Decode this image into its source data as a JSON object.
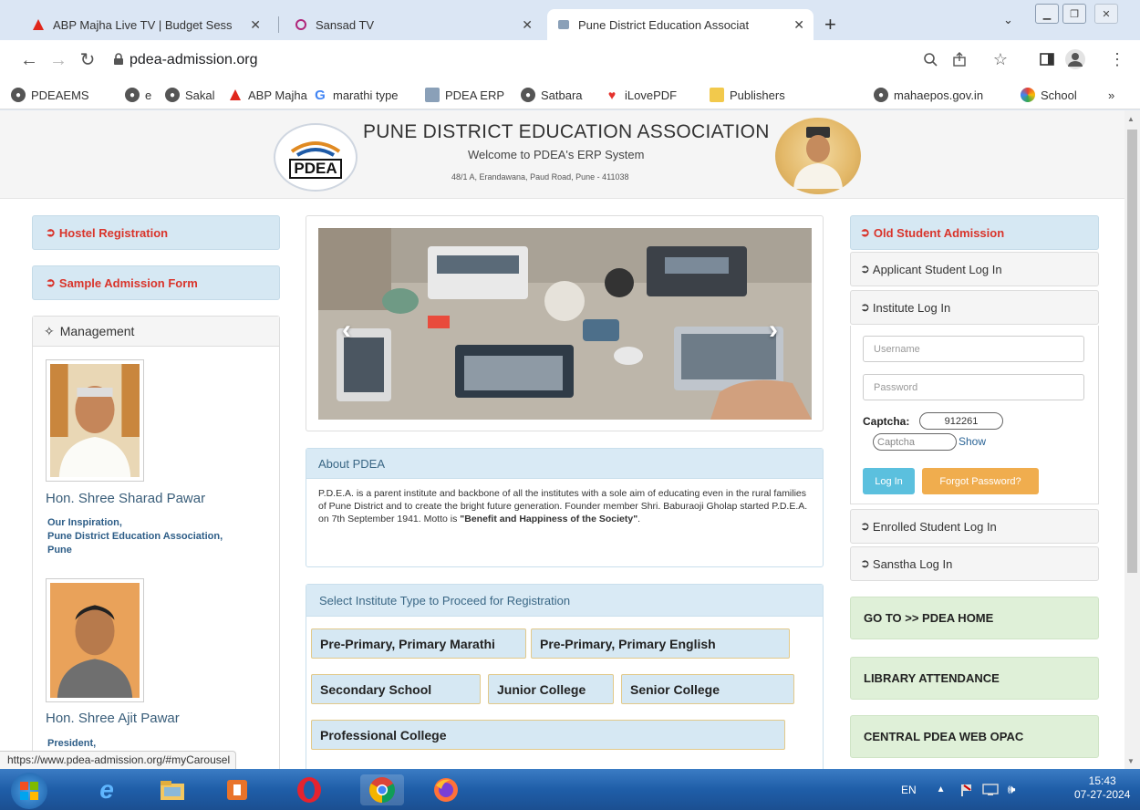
{
  "browser": {
    "tabs": [
      {
        "title": "ABP Majha Live TV | Budget Sess",
        "active": false
      },
      {
        "title": "Sansad TV",
        "active": false
      },
      {
        "title": "Pune District Education Associat",
        "active": true
      }
    ],
    "url": "pdea-admission.org",
    "bookmarks": [
      "PDEAEMS",
      "e",
      "Sakal",
      "ABP Majha",
      "marathi type",
      "PDEA ERP",
      "Satbara",
      "iLovePDF",
      "Publishers",
      "mahaepos.gov.in",
      "School"
    ],
    "bookmarks_more": "»",
    "status_url": "https://www.pdea-admission.org/#myCarousel"
  },
  "header": {
    "logo_text": "PDEA",
    "title": "PUNE DISTRICT EDUCATION ASSOCIATION",
    "welcome": "Welcome to PDEA's ERP System",
    "address": "48/1 A, Erandawana, Paud Road, Pune - 411038"
  },
  "left": {
    "hostel": "Hostel Registration",
    "sample_form": "Sample Admission Form",
    "management_title": "Management",
    "people": [
      {
        "name": "Hon. Shree Sharad Pawar",
        "role1": "Our Inspiration,",
        "role2": "Pune District Education Association,",
        "role3": "Pune"
      },
      {
        "name": "Hon. Shree Ajit Pawar",
        "role1": "President,"
      }
    ]
  },
  "about": {
    "title": "About PDEA",
    "text": "P.D.E.A. is a parent institute and backbone of all the institutes with a sole aim of educating even in the rural families of Pune District and to create the bright future generation. Founder member Shri. Baburaoji Gholap started P.D.E.A. on 7th September 1941. Motto is ",
    "motto": "\"Benefit and Happiness of the Society\"",
    "end": "."
  },
  "select_institute": {
    "title": "Select Institute Type to Proceed for Registration",
    "types": [
      "Pre-Primary, Primary Marathi",
      "Pre-Primary, Primary English",
      "Secondary School",
      "Junior College",
      "Senior College",
      "Professional College"
    ]
  },
  "right": {
    "old_admission": "Old Student Admission",
    "applicant_login": "Applicant Student Log In",
    "institute_login": "Institute Log In",
    "username_placeholder": "Username",
    "password_placeholder": "Password",
    "captcha_label": "Captcha:",
    "captcha_value": "912261",
    "captcha_placeholder": "Captcha",
    "captcha_show": "Show",
    "login_btn": "Log In",
    "forgot_btn": "Forgot Password?",
    "enrolled_login": "Enrolled Student Log In",
    "sanstha_login": "Sanstha Log In",
    "links": [
      "GO TO >> PDEA HOME",
      "LIBRARY ATTENDANCE",
      "CENTRAL PDEA WEB OPAC"
    ]
  },
  "taskbar": {
    "lang": "EN",
    "time": "15:43",
    "date": "07-27-2024"
  },
  "colors": {
    "accent_red": "#d9342b",
    "panel_blue": "#d6e8f3",
    "panel_green": "#dff0d8",
    "login_blue": "#5bc0de",
    "forgot_orange": "#f0ad4e"
  }
}
